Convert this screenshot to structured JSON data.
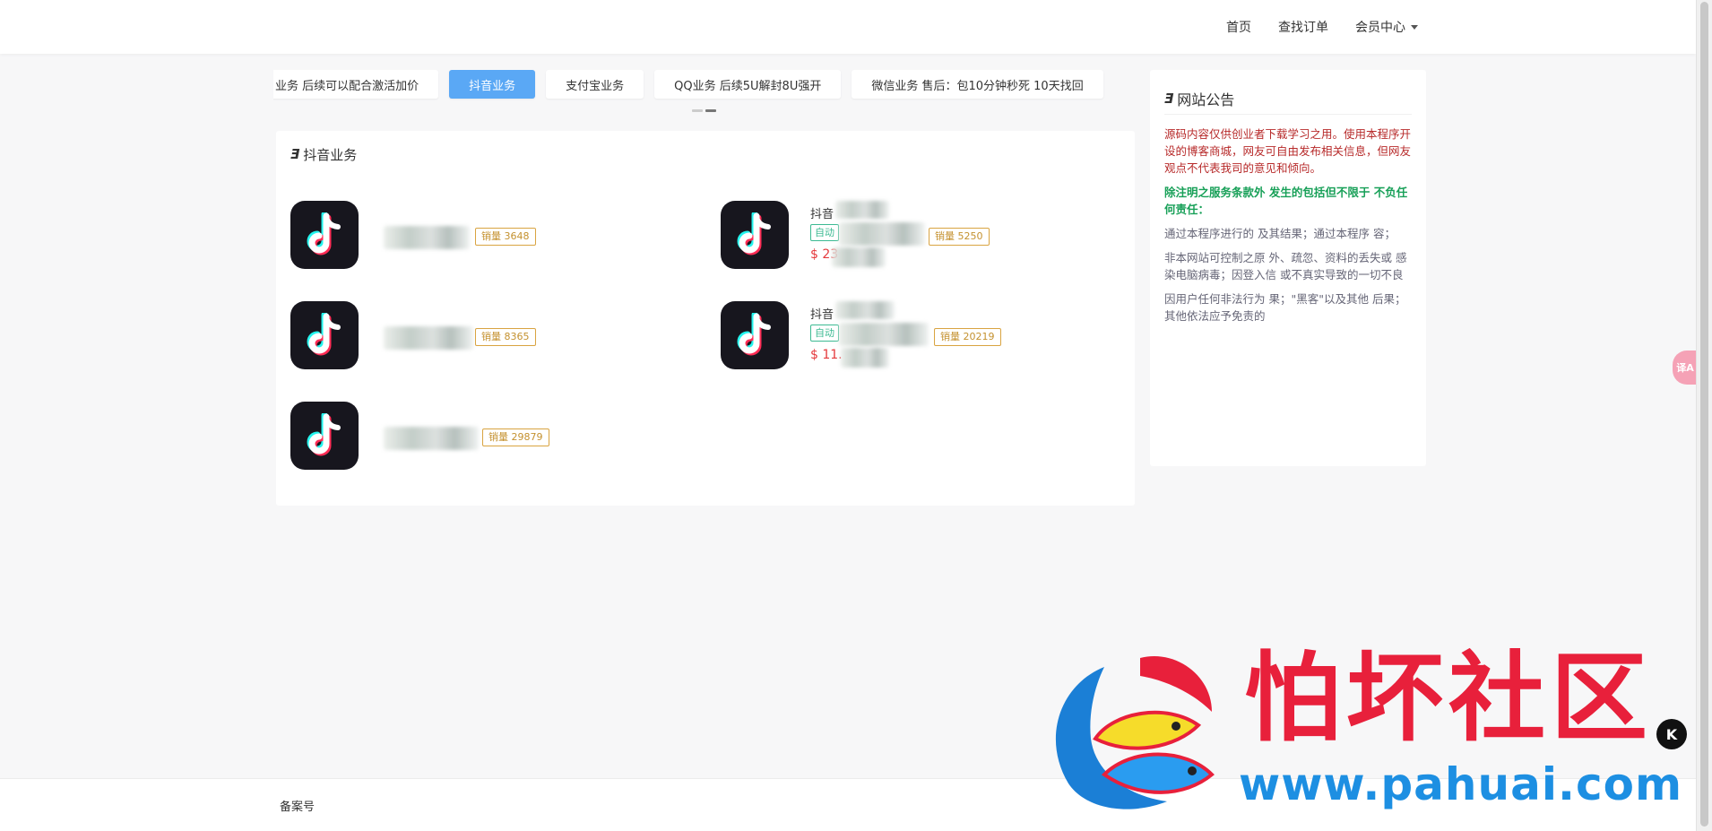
{
  "nav": {
    "home": "首页",
    "find_order": "查找订单",
    "member_center": "会员中心"
  },
  "tabs": [
    {
      "label": "业务 后续可以配合激活加价",
      "active": false
    },
    {
      "label": "抖音业务",
      "active": true
    },
    {
      "label": "支付宝业务",
      "active": false
    },
    {
      "label": "QQ业务 后续5U解封8U强开",
      "active": false
    },
    {
      "label": "微信业务 售后：包10分钟秒死 10天找回",
      "active": false
    }
  ],
  "panel": {
    "title": "抖音业务",
    "products": [
      {
        "name": "",
        "tag": "",
        "price": "",
        "sales": "销量 3648"
      },
      {
        "name": "抖音",
        "tag": "自动",
        "price": "$ 23",
        "sales": "销量 5250"
      },
      {
        "name": "",
        "tag": "",
        "price": "",
        "sales": "销量 8365"
      },
      {
        "name": "抖音",
        "tag": "自动",
        "price": "$ 11.",
        "sales": "销量 20219"
      },
      {
        "name": "",
        "tag": "",
        "price": "",
        "sales": "销量 29879"
      }
    ]
  },
  "notice": {
    "title": "网站公告",
    "p1": "源码内容仅供创业者下载学习之用。使用本程序开设的博客商城，网友可自由发布相关信息，但网友观点不代表我司的意见和倾向。",
    "p2": "除注明之服务条款外 发生的包括但不限于 不负任何责任：",
    "p3": "通过本程序进行的 及其结果；通过本程序 容；",
    "p4": "非本网站可控制之原 外、疏忽、资料的丢失或 感染电脑病毒；因登入信 或不真实导致的一切不良",
    "p5": "因用户任何非法行为 果；\"黑客\"以及其他 后果；其他依法应予免责的"
  },
  "footer": {
    "icp": "备案号"
  },
  "float_button": {
    "label": "译A"
  },
  "watermark": {
    "title": "怕坏社区",
    "url": "www.pahuai.com",
    "badge": "K"
  },
  "colors": {
    "accent": "#5aa8f5",
    "price": "#e4393c",
    "tag_green": "#3cba92",
    "sales_gold": "#c4912f",
    "notice_red": "#b72a2a",
    "notice_green": "#18a058"
  }
}
